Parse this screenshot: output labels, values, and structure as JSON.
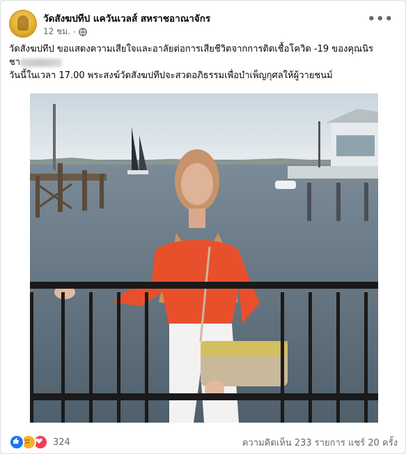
{
  "post": {
    "page_name": "วัดสังฆปทีป แควันเวลส์ สหราชอาณาจักร",
    "time": "12 ชม.",
    "privacy_icon": "globe-icon",
    "more_icon": "more-options-icon",
    "text": {
      "line1": "วัดสังฆปทีป ขอแสดงความเสียใจและอาลัยต่อการเสียชีวิตจากการติดเชื้อโควิด -19 ของคุณนิร",
      "line2_prefix": "ชา",
      "line3": "วันนี้ในเวลา 17.00 พระสงฆ์วัดสังฆปทีปจะสวดอภิธรรมเพื่อบำเพ็ญกุศลให้ผู้วายชนม์"
    },
    "photo": {
      "description_icon": "photo"
    },
    "reactions": {
      "icons": [
        "like-icon",
        "sad-icon",
        "love-icon"
      ],
      "count": "324"
    },
    "stats": {
      "comments": "ความคิดเห็น 233 รายการ",
      "shares": "แชร์ 20 ครั้ง"
    }
  }
}
